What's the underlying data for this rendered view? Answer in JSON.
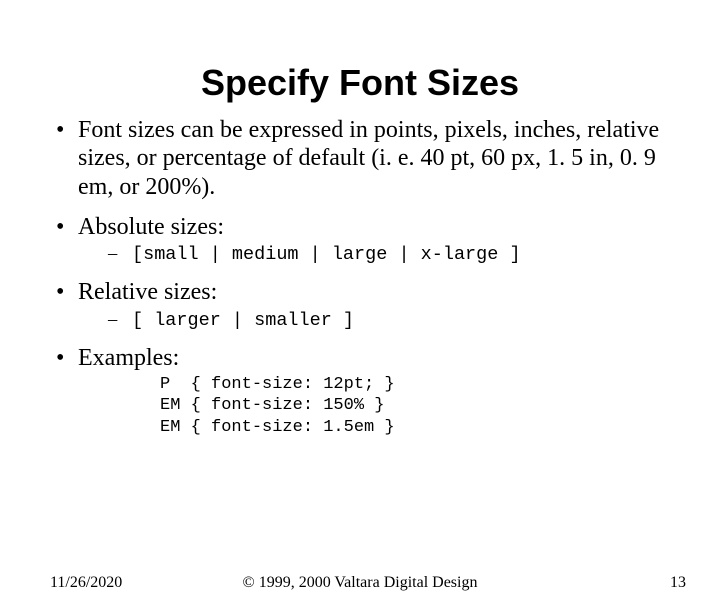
{
  "title": "Specify Font Sizes",
  "bullets": {
    "b1": "Font sizes can be expressed in points, pixels, inches, relative sizes, or percentage of default (i. e. 40 pt, 60 px, 1. 5 in, 0. 9 em, or 200%).",
    "b2": "Absolute sizes:",
    "b2sub": "[small | medium | large | x-large ]",
    "b3": "Relative sizes:",
    "b3sub": "[ larger | smaller ]",
    "b4": "Examples:",
    "code": "P  { font-size: 12pt; }\nEM { font-size: 150% }\nEM { font-size: 1.5em }"
  },
  "footer": {
    "date": "11/26/2020",
    "copyright": "© 1999, 2000 Valtara Digital Design",
    "page": "13"
  }
}
